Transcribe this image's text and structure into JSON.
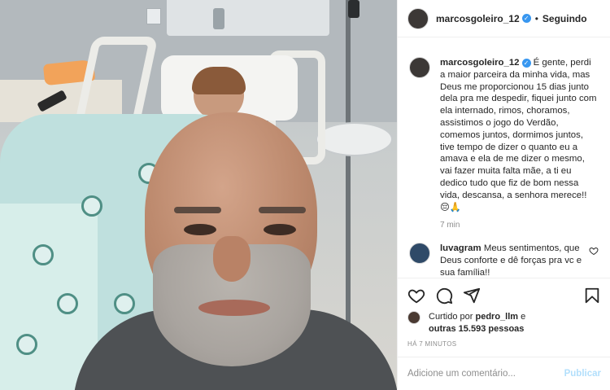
{
  "post": {
    "username": "marcosgoleiro_12",
    "follow_label": "Seguindo",
    "separator": "•",
    "verified_mark": "✓"
  },
  "caption": {
    "username": "marcosgoleiro_12",
    "text": "É gente, perdi a maior parceira da minha vida, mas Deus me proporcionou 15 dias junto dela pra me despedir, fiquei junto com ela internado, rimos, choramos, assistimos o jogo do Verdão, comemos juntos, dormimos juntos, tive tempo de dizer o quanto eu a amava e ela de me dizer o mesmo, vai fazer muita falta mãe, a ti eu dedico tudo que fiz de bom nessa vida, descansa, a senhora merece!! 😔🙏",
    "time": "7 min"
  },
  "comment": {
    "username": "luvagram",
    "text": "Meus sentimentos, que Deus conforte e dê forças pra vc e sua família!!"
  },
  "likes": {
    "prefix": "Curtido por",
    "user": "pedro_llm",
    "middle": "e",
    "others": "outras 15.593 pessoas"
  },
  "posted_ago": "HÁ 7 MINUTOS",
  "add_comment": {
    "placeholder": "Adicione um comentário...",
    "publish_label": "Publicar"
  },
  "icons": {
    "like": "heart-icon",
    "comment": "comment-icon",
    "share": "share-icon",
    "save": "bookmark-icon"
  }
}
